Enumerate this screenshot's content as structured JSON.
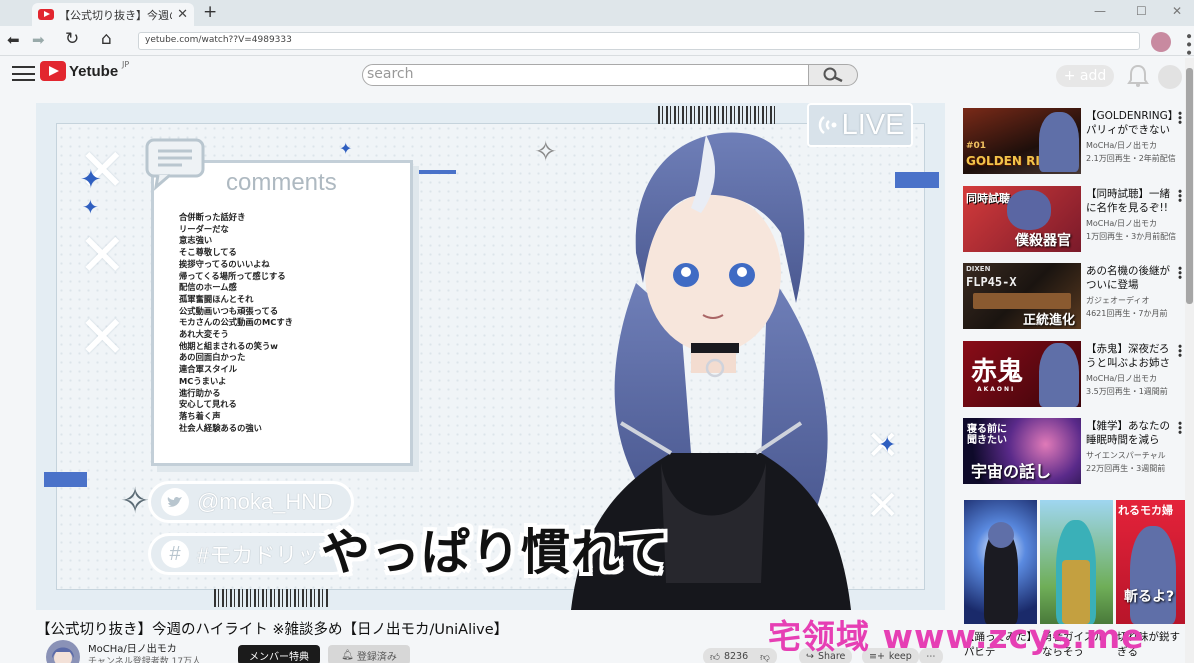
{
  "browser": {
    "tab_title": "【公式切り抜き】今週の",
    "tab_close": "✕",
    "new_tab": "+",
    "url": "yetube.com/watch??V=4989333",
    "back": "⬅",
    "forward": "➡",
    "reload": "↻",
    "home": "⌂",
    "menu": "•••",
    "win_min": "—",
    "win_max": "☐",
    "win_close": "✕"
  },
  "site": {
    "logo": "Yetube",
    "region": "JP",
    "search_placeholder": "search",
    "add_label": "+ add"
  },
  "player": {
    "live_label": "LIVE",
    "comments_title": "comments",
    "comments": [
      "合併断った話好き",
      "リーダーだな",
      "意志強い",
      "そこ尊敬してる",
      "挨拶守ってるのいいよね",
      "帰ってくる場所って感じする",
      "配信のホーム感",
      "孤軍奮闘ほんとそれ",
      "公式動画いつも頑張ってる",
      "モカさんの公式動画のMCすき",
      "あれ大変そう",
      "他期と組まされるの笑うw",
      "あの回面白かった",
      "連合軍スタイル",
      "MCうまいよ",
      "進行助かる",
      "安心して見れる",
      "落ち着く声",
      "社会人経験あるの強い"
    ],
    "twitter_handle": "@moka_HND",
    "hashtag": "#モカドリッ",
    "subtitle": "やっぱり慣れて"
  },
  "video": {
    "title": "【公式切り抜き】今週のハイライト ※雑談多め【日ノ出モカ/UniAlive】",
    "channel_name": "MoCHa/日ノ出モカ",
    "subscribers": "チャンネル登録者数 17万人",
    "member_label": "メンバー特典",
    "subscribed_label": "登録済み",
    "like_count": "8236",
    "share_label": "Share",
    "keep_label": "keep"
  },
  "sidebar": {
    "recommendations": [
      {
        "title": "【GOLDENRING】パリィができない",
        "channel": "MoCHa/日ノ出モカ",
        "meta": "2.1万回再生・2年前配信",
        "thumb_text": "GOLDEN RING",
        "thumb_badge": "#01"
      },
      {
        "title": "【同時試聴】一緒に名作を見るぞ!!",
        "channel": "MoCHa/日ノ出モカ",
        "meta": "1万回再生・3か月前配信",
        "thumb_text": "僕殺器官",
        "thumb_badge": "同時試聴"
      },
      {
        "title": "あの名機の後継がついに登場",
        "channel": "ガジェオーディオ",
        "meta": "4621回再生・7か月前",
        "thumb_text": "正統進化",
        "thumb_badge": "FLP45-X",
        "thumb_brand": "DIXEN"
      },
      {
        "title": "【赤鬼】深夜だろうと叫ぶよお姉さ",
        "channel": "MoCHa/日ノ出モカ",
        "meta": "3.5万回再生・1週間前",
        "thumb_text": "赤鬼",
        "thumb_badge": "AKAONI"
      },
      {
        "title": "【雑学】あなたの睡眠時間を減ら",
        "channel": "サイエンスパーチャル",
        "meta": "22万回再生・3週間前",
        "thumb_text": "宇宙の話し",
        "thumb_badge": "寝る前に聞きたい"
      }
    ],
    "shorts": [
      {
        "caption": "【踊ってみた】パビデ"
      },
      {
        "caption": "勇者ガイスルならそう"
      },
      {
        "caption": "切れ味が鋭すぎる",
        "thumb_text": "れるモカ婦",
        "thumb_sub": "斬るよ?"
      }
    ]
  },
  "watermark": "宅领域 www.zcys.me",
  "colors": {
    "accent_red": "#e2262f",
    "live_blue": "#2f5fc0",
    "watermark": "#e63fb4"
  }
}
